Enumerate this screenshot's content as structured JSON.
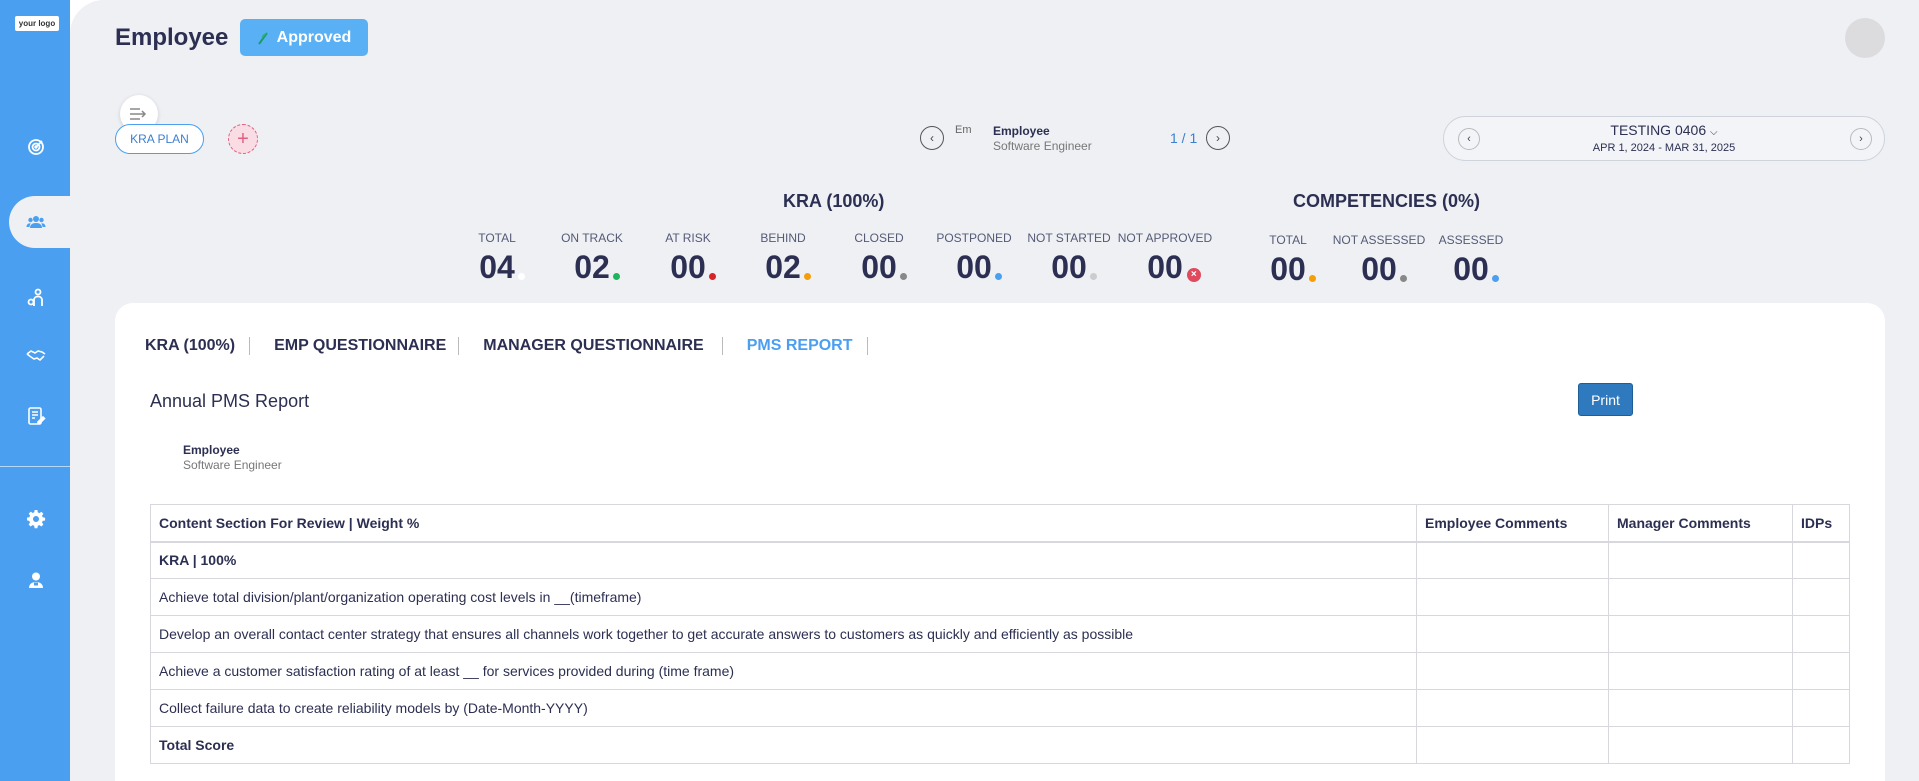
{
  "logo": {
    "text": "your logo"
  },
  "sidebar": {
    "icons": [
      "target-icon",
      "users-icon",
      "person-icon",
      "handshake-icon",
      "edit-report-icon",
      "settings-icon",
      "user-support-icon"
    ]
  },
  "header": {
    "title": "Employee",
    "status": "Approved"
  },
  "toolbar": {
    "kra_plan": "KRA PLAN",
    "add": "+"
  },
  "employee": {
    "img_alt": "Em",
    "name": "Employee",
    "role": "Software Engineer",
    "pager": "1 / 1"
  },
  "period": {
    "title": "TESTING 0406",
    "dates": "APR 1, 2024 - MAR 31, 2025"
  },
  "kra_summary": {
    "title": "KRA (100%)",
    "stats": [
      {
        "label": "TOTAL",
        "value": "04",
        "color": "#ffffff"
      },
      {
        "label": "ON TRACK",
        "value": "02",
        "color": "#22b35e"
      },
      {
        "label": "AT RISK",
        "value": "00",
        "color": "#d8232a"
      },
      {
        "label": "BEHIND",
        "value": "02",
        "color": "#f59e0b"
      },
      {
        "label": "CLOSED",
        "value": "00",
        "color": "#888888"
      },
      {
        "label": "POSTPONED",
        "value": "00",
        "color": "#4a9ff0"
      },
      {
        "label": "NOT STARTED",
        "value": "00",
        "color": "#cccccc"
      },
      {
        "label": "NOT APPROVED",
        "value": "00",
        "color": "#e04a5e"
      }
    ]
  },
  "competencies_summary": {
    "title": "COMPETENCIES (0%)",
    "stats": [
      {
        "label": "TOTAL",
        "value": "00",
        "color": "#f59e0b"
      },
      {
        "label": "NOT ASSESSED",
        "value": "00",
        "color": "#888888"
      },
      {
        "label": "ASSESSED",
        "value": "00",
        "color": "#4a9ff0"
      }
    ]
  },
  "tabs": [
    {
      "label": "KRA (100%)"
    },
    {
      "label": "EMP QUESTIONNAIRE"
    },
    {
      "label": "MANAGER QUESTIONNAIRE"
    },
    {
      "label": "PMS REPORT"
    }
  ],
  "report": {
    "title": "Annual PMS Report",
    "print": "Print",
    "employee_name": "Employee",
    "employee_role": "Software Engineer",
    "columns": [
      "Content Section For Review | Weight %",
      "Employee Comments",
      "Manager Comments",
      "IDPs"
    ],
    "rows": [
      "KRA | 100%",
      "Achieve total division/plant/organization operating cost levels in __(timeframe)",
      "Develop an overall contact center strategy that ensures all channels work together to get accurate answers to customers as quickly and efficiently as possible",
      "Achieve a customer satisfaction rating of at least __ for services provided during (time frame)",
      "Collect failure data to create reliability models by (Date-Month-YYYY)",
      "Total Score"
    ]
  }
}
